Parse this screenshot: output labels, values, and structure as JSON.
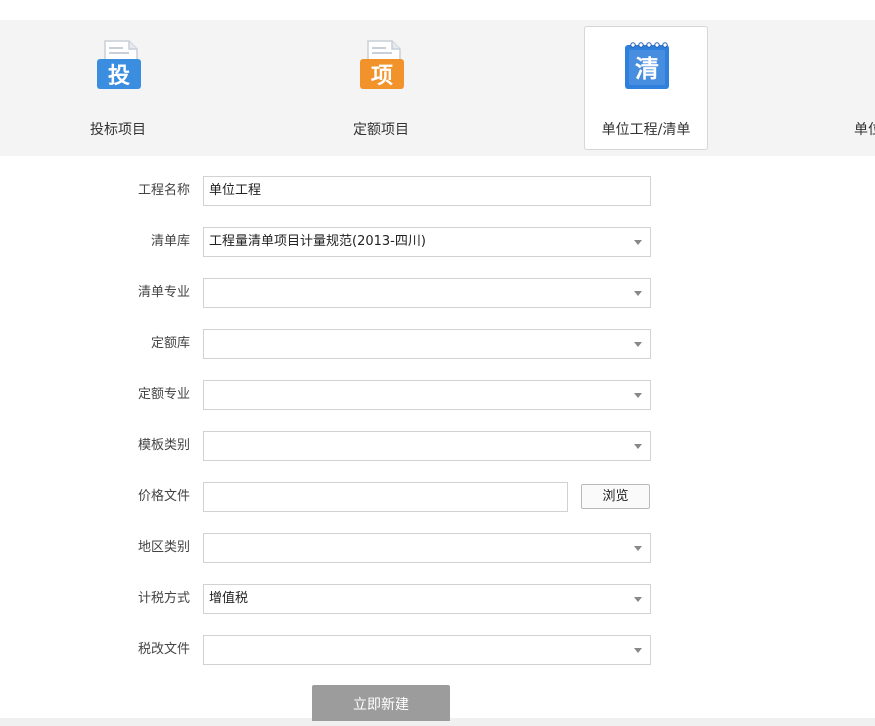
{
  "tabs": [
    {
      "label": "投标项目",
      "icon_char": "投",
      "icon": "bid-file-icon",
      "color": "#3b8de0"
    },
    {
      "label": "定额项目",
      "icon_char": "项",
      "icon": "quota-file-icon",
      "color": "#f2922a"
    },
    {
      "label": "单位工程/清单",
      "icon_char": "清",
      "icon": "list-notebook-icon",
      "color": "#2f7fdc",
      "active": true
    },
    {
      "label": "单位",
      "icon": "unit-icon"
    }
  ],
  "form": {
    "project_name": {
      "label": "工程名称",
      "value": "单位工程"
    },
    "list_lib": {
      "label": "清单库",
      "value": "工程量清单项目计量规范(2013-四川)"
    },
    "list_major": {
      "label": "清单专业",
      "value": ""
    },
    "quota_lib": {
      "label": "定额库",
      "value": ""
    },
    "quota_major": {
      "label": "定额专业",
      "value": ""
    },
    "template_type": {
      "label": "模板类别",
      "value": ""
    },
    "price_file": {
      "label": "价格文件",
      "value": "",
      "browse_label": "浏览"
    },
    "region_type": {
      "label": "地区类别",
      "value": ""
    },
    "tax_method": {
      "label": "计税方式",
      "value": "增值税"
    },
    "tax_file": {
      "label": "税改文件",
      "value": ""
    }
  },
  "create_button": "立即新建",
  "colors": {
    "tab_bg": "#f4f4f4",
    "button_bg": "#9c9c9c"
  }
}
